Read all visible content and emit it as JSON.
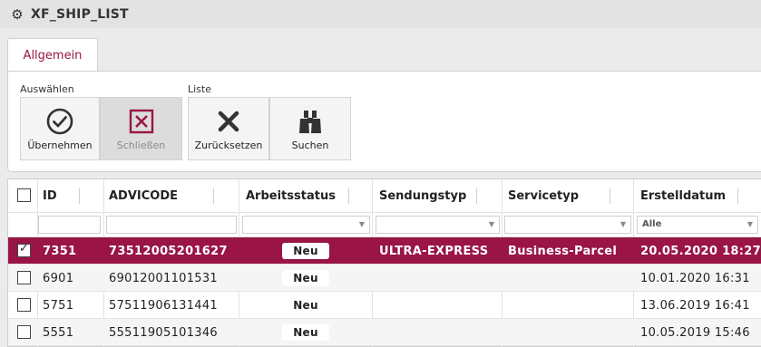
{
  "window": {
    "title": "XF_SHIP_LIST",
    "icon": "app-cog-icon"
  },
  "tabs": [
    {
      "label": "Allgemein",
      "active": true
    }
  ],
  "ribbon": {
    "groups": [
      {
        "label": "Auswählen",
        "buttons": [
          {
            "label": "Übernehmen",
            "icon": "check-circle-icon",
            "enabled": true
          },
          {
            "label": "Schließen",
            "icon": "close-box-icon",
            "enabled": false
          }
        ]
      },
      {
        "label": "Liste",
        "buttons": [
          {
            "label": "Zurücksetzen",
            "icon": "x-icon",
            "enabled": true
          },
          {
            "label": "Suchen",
            "icon": "binoculars-icon",
            "enabled": true
          }
        ]
      }
    ]
  },
  "grid": {
    "columns": [
      "ID",
      "ADVICODE",
      "Arbeitsstatus",
      "Sendungstyp",
      "Servicetyp",
      "Erstelldatum"
    ],
    "filters": {
      "erstelldatum": "Alle"
    },
    "rows": [
      {
        "id": "7351",
        "advicode": "73512005201627",
        "status": "Neu",
        "sendungstyp": "ULTRA-EXPRESS",
        "servicetyp": "Business-Parcel",
        "erstelldatum": "20.05.2020 18:27",
        "selected": true
      },
      {
        "id": "6901",
        "advicode": "69012001101531",
        "status": "Neu",
        "sendungstyp": "",
        "servicetyp": "",
        "erstelldatum": "10.01.2020 16:31",
        "selected": false
      },
      {
        "id": "5751",
        "advicode": "57511906131441",
        "status": "Neu",
        "sendungstyp": "",
        "servicetyp": "",
        "erstelldatum": "13.06.2019 16:41",
        "selected": false
      },
      {
        "id": "5551",
        "advicode": "55511905101346",
        "status": "Neu",
        "sendungstyp": "",
        "servicetyp": "",
        "erstelldatum": "10.05.2019 15:46",
        "selected": false
      }
    ]
  },
  "colors": {
    "accent": "#9a1446",
    "icon": "#333333"
  }
}
